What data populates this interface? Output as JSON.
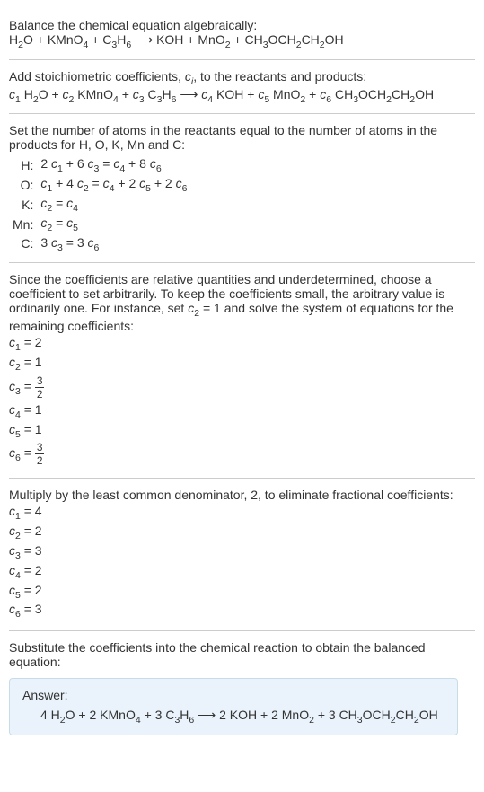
{
  "section1": {
    "title": "Balance the chemical equation algebraically:",
    "equation": "H₂O + KMnO₄ + C₃H₆ ⟶ KOH + MnO₂ + CH₃OCH₂CH₂OH"
  },
  "section2": {
    "title_part1": "Add stoichiometric coefficients, ",
    "title_var": "cᵢ",
    "title_part2": ", to the reactants and products:",
    "equation": "c₁ H₂O + c₂ KMnO₄ + c₃ C₃H₆ ⟶ c₄ KOH + c₅ MnO₂ + c₆ CH₃OCH₂CH₂OH"
  },
  "section3": {
    "title": "Set the number of atoms in the reactants equal to the number of atoms in the products for H, O, K, Mn and C:",
    "rows": [
      {
        "el": "H:",
        "eq": "2 c₁ + 6 c₃ = c₄ + 8 c₆"
      },
      {
        "el": "O:",
        "eq": "c₁ + 4 c₂ = c₄ + 2 c₅ + 2 c₆"
      },
      {
        "el": "K:",
        "eq": "c₂ = c₄"
      },
      {
        "el": "Mn:",
        "eq": "c₂ = c₅"
      },
      {
        "el": "C:",
        "eq": "3 c₃ = 3 c₆"
      }
    ]
  },
  "section4": {
    "title": "Since the coefficients are relative quantities and underdetermined, choose a coefficient to set arbitrarily. To keep the coefficients small, the arbitrary value is ordinarily one. For instance, set c₂ = 1 and solve the system of equations for the remaining coefficients:",
    "coeffs": [
      {
        "var": "c₁",
        "val": "2",
        "frac": false
      },
      {
        "var": "c₂",
        "val": "1",
        "frac": false
      },
      {
        "var": "c₃",
        "num": "3",
        "den": "2",
        "frac": true
      },
      {
        "var": "c₄",
        "val": "1",
        "frac": false
      },
      {
        "var": "c₅",
        "val": "1",
        "frac": false
      },
      {
        "var": "c₆",
        "num": "3",
        "den": "2",
        "frac": true
      }
    ]
  },
  "section5": {
    "title": "Multiply by the least common denominator, 2, to eliminate fractional coefficients:",
    "coeffs": [
      {
        "var": "c₁",
        "val": "4"
      },
      {
        "var": "c₂",
        "val": "2"
      },
      {
        "var": "c₃",
        "val": "3"
      },
      {
        "var": "c₄",
        "val": "2"
      },
      {
        "var": "c₅",
        "val": "2"
      },
      {
        "var": "c₆",
        "val": "3"
      }
    ]
  },
  "section6": {
    "title": "Substitute the coefficients into the chemical reaction to obtain the balanced equation:",
    "answer_label": "Answer:",
    "answer_eq": "4 H₂O + 2 KMnO₄ + 3 C₃H₆ ⟶ 2 KOH + 2 MnO₂ + 3 CH₃OCH₂CH₂OH"
  }
}
